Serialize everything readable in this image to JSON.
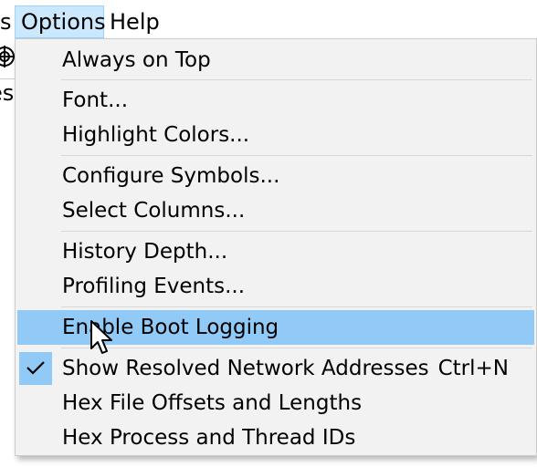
{
  "menubar": {
    "partial_label": "s",
    "options_label": "Options",
    "help_label": "Help"
  },
  "background": {
    "partial_text": "es"
  },
  "options_menu": {
    "items": [
      {
        "label": "Always on Top"
      },
      {
        "label": "Font..."
      },
      {
        "label": "Highlight Colors..."
      },
      {
        "label": "Configure Symbols..."
      },
      {
        "label": "Select Columns..."
      },
      {
        "label": "History Depth..."
      },
      {
        "label": "Profiling Events..."
      },
      {
        "label": "Enable Boot Logging",
        "highlighted": true
      },
      {
        "label": "Show Resolved Network Addresses",
        "shortcut": "Ctrl+N",
        "checked": true
      },
      {
        "label": "Hex File Offsets and Lengths"
      },
      {
        "label": "Hex Process and Thread IDs"
      }
    ]
  },
  "colors": {
    "menubar_selected_bg": "#cce8ff",
    "menu_bg": "#f2f2f2",
    "highlight_bg": "#91c9f7"
  },
  "icons": {
    "check": "check-icon",
    "cursor": "mouse-pointer-icon",
    "toolbar": "target-icon"
  }
}
